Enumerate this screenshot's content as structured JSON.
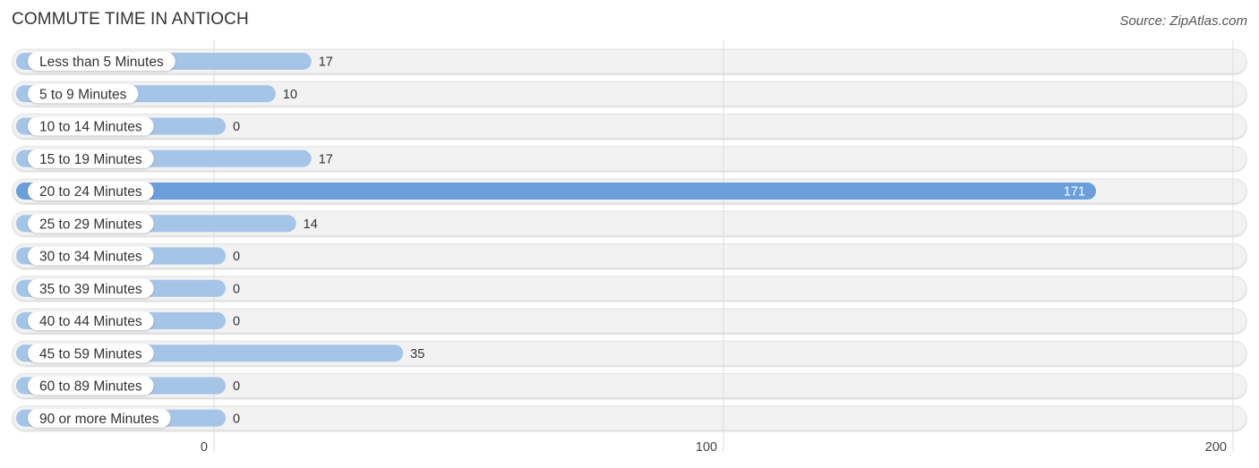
{
  "header": {
    "title": "COMMUTE TIME IN ANTIOCH",
    "source": "Source: ZipAtlas.com"
  },
  "colors": {
    "bar": "#a4c4e8",
    "bar_highlight": "#6a9fdc",
    "track": "#f2f2f2",
    "grid": "#dddddd"
  },
  "chart_data": {
    "type": "bar",
    "orientation": "horizontal",
    "title": "COMMUTE TIME IN ANTIOCH",
    "xlabel": "",
    "ylabel": "",
    "categories": [
      "Less than 5 Minutes",
      "5 to 9 Minutes",
      "10 to 14 Minutes",
      "15 to 19 Minutes",
      "20 to 24 Minutes",
      "25 to 29 Minutes",
      "30 to 34 Minutes",
      "35 to 39 Minutes",
      "40 to 44 Minutes",
      "45 to 59 Minutes",
      "60 to 89 Minutes",
      "90 or more Minutes"
    ],
    "values": [
      17,
      10,
      0,
      17,
      171,
      14,
      0,
      0,
      0,
      35,
      0,
      0
    ],
    "highlight_index": 4,
    "xlim": [
      0,
      200
    ],
    "xticks": [
      0,
      100,
      200
    ],
    "xtick_labels": [
      "0",
      "100",
      "200"
    ],
    "grid": true,
    "legend": "none"
  }
}
